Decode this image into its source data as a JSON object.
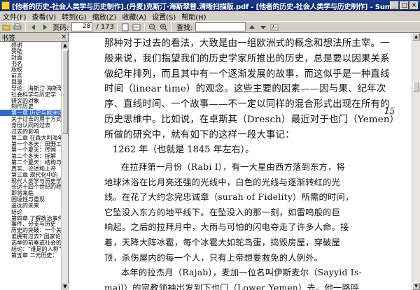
{
  "window": {
    "title": "[他者的历史-社会人类学与历史制作].(丹麦)克斯汀·海斯翠普.清晰扫描版.pdf - [他者的历史-社会人类学与历史制作] - SumatraPDF",
    "buttons": {
      "minimize": "_",
      "maximize": "□",
      "close": "×"
    }
  },
  "menu": [
    "文件(F)",
    "查看(V)",
    "转到(G)",
    "缩放(Z)",
    "收藏(A)",
    "设置(S)",
    "帮助(H)"
  ],
  "toolbar": {
    "page_label": "页码:",
    "page_value": "28",
    "page_total": "/ 173",
    "find_label": "查找:",
    "icons": [
      "open-icon",
      "print-icon",
      "prev-page-icon",
      "next-page-icon",
      "fit-page-icon",
      "fit-width-icon",
      "zoom-out-icon",
      "zoom-in-icon",
      "find-prev-icon",
      "find-next-icon",
      "match-case-icon"
    ]
  },
  "sidebar": {
    "title": "书签",
    "close": "×",
    "items": [
      "感谢",
      "赞助",
      "封面",
      "书名",
      "版权",
      "前言",
      "目录",
      "导论：海斯汀·海斯翠普",
      "社会科学与历史学",
      "研究的对象",
      "制作历史",
      "第一章 历史与欧洲以外",
      "关于过去的用于方式",
      "身份认同的过去",
      "过去的影响",
      "第二章 在森大利海年",
      "第一个冬天：田野工",
      "第一个夏天：传闻",
      "第二个冬天：拆解",
      "第二个夏天：结构与",
      "真实、论述和上帝",
      "第三章 现代化中的",
      "现代人类学与历史学",
      "长达十四个世纪的相",
      "即将来临",
      "困境性与重现",
      "遥远的未来",
      "结论",
      "第四章 了解政治事件",
      "事件、分支与历史",
      "历史的突破：一个关",
      "谁拥有过去? 国家论",
      "选举的前奏或社会的",
      "结论：\"谁是的人称\"",
      "第五章 二元历史："
    ],
    "selected_index": 11
  },
  "document": {
    "main_lines": [
      "那种对于过去的看法，大致是由一组欧洲式的概念和想法所主宰。一",
      "般来说，我们指望我们的历史学家所推出的历史，总是要以因果关系",
      "做纪年排列，而且其中有一个逐渐发展的故事，而这似乎是一种直线",
      "时间（linear time）的观念。这些主要的因素——因与果、纪年次",
      "序、直线时间、一个故事——不一定以同样的混合形式出现在所有的",
      "历史思维中。比如说，在卓斯其（Dresch）最近对于也门（Yemen）",
      "所做的研究中，就有如下的这样一段大事记："
    ],
    "margin_number": "15",
    "year_line": "1262 年（也就是 1845 年左右）。",
    "quote_lines": [
      "在拉拜第一月份（Rabi I），有一大星由西方落到东方，将",
      "地球沐浴在比月亮还强的光线中，白色的光线与逐渐转红的光",
      "线。在花了大约念完忠诚章（surah of Fidelity）所需的时间，",
      "它坠没入东方的地平线下。在坠没入的那一刻，如雷鸣般的巨",
      "响起。之后的拉拜月中，大雨与可怕的闪电夺走了许多人命。接",
      "着，天降大阵冰雹，每个冰雹大如鸵鸟蛋，捣毁房屋，穿破屋",
      "顶，杀伤屋内的每一个人，只有上帝想要救免的人例外。",
      "本年的拉杰月（Rajab），麦加一位名叫伊斯麦尔（Sayyid Is-",
      "mail）的宗教领袖出发到下也门（Lower Yemen）去。他一路呼"
    ]
  }
}
